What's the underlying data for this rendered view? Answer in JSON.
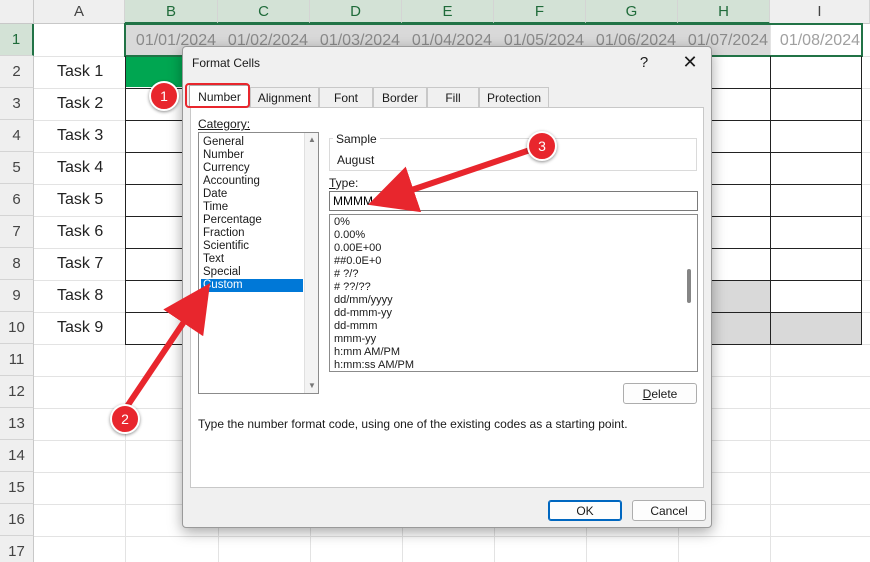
{
  "sheet": {
    "columns": [
      "A",
      "B",
      "C",
      "D",
      "E",
      "F",
      "G",
      "H",
      "I"
    ],
    "rows": [
      "1",
      "2",
      "3",
      "4",
      "5",
      "6",
      "7",
      "8",
      "9",
      "10",
      "11",
      "12",
      "13",
      "14",
      "15",
      "16",
      "17"
    ],
    "dates": [
      "01/01/2024",
      "01/02/2024",
      "01/03/2024",
      "01/04/2024",
      "01/05/2024",
      "01/06/2024",
      "01/07/2024",
      "01/08/2024"
    ],
    "tasks": [
      "Task 1",
      "Task 2",
      "Task 3",
      "Task 4",
      "Task 5",
      "Task 6",
      "Task 7",
      "Task 8",
      "Task 9"
    ],
    "colors": {
      "fill_green": "#00a651",
      "selection": "#217346"
    }
  },
  "dialog": {
    "title": "Format Cells",
    "help_label": "?",
    "close_label": "✕",
    "tabs": [
      "Number",
      "Alignment",
      "Font",
      "Border",
      "Fill",
      "Protection"
    ],
    "active_tab": "Number",
    "category_label": "Category:",
    "categories": [
      "General",
      "Number",
      "Currency",
      "Accounting",
      "Date",
      "Time",
      "Percentage",
      "Fraction",
      "Scientific",
      "Text",
      "Special",
      "Custom"
    ],
    "selected_category": "Custom",
    "sample_label": "Sample",
    "sample_value": "August",
    "type_label": "Type:",
    "type_value": "MMMM",
    "formats": [
      "0%",
      "0.00%",
      "0.00E+00",
      "##0.0E+0",
      "# ?/?",
      "# ??/??",
      "dd/mm/yyyy",
      "dd-mmm-yy",
      "dd-mmm",
      "mmm-yy",
      "h:mm AM/PM",
      "h:mm:ss AM/PM"
    ],
    "delete_label": "Delete",
    "description": "Type the number format code, using one of the existing codes as a starting point.",
    "ok_label": "OK",
    "cancel_label": "Cancel"
  },
  "callouts": [
    "1",
    "2",
    "3"
  ],
  "callout_color": "#e8262d"
}
